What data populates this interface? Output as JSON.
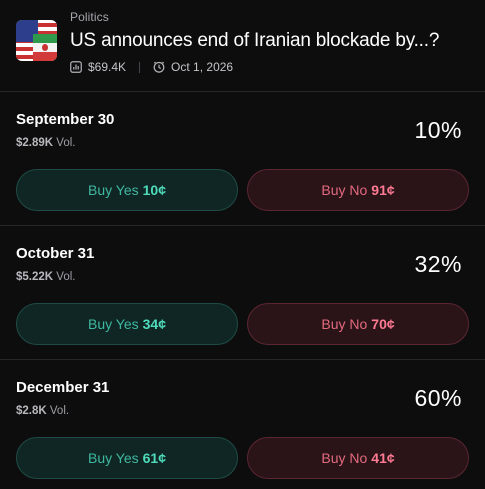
{
  "header": {
    "category": "Politics",
    "title": "US announces end of Iranian blockade by...?",
    "volume": "$69.4K",
    "end_date": "Oct 1, 2026"
  },
  "markets": [
    {
      "date": "September 30",
      "volume": "$2.89K",
      "vol_suffix": "Vol.",
      "probability": "10%",
      "yes_label": "Buy Yes",
      "yes_price": "10¢",
      "no_label": "Buy No",
      "no_price": "91¢"
    },
    {
      "date": "October 31",
      "volume": "$5.22K",
      "vol_suffix": "Vol.",
      "probability": "32%",
      "yes_label": "Buy Yes",
      "yes_price": "34¢",
      "no_label": "Buy No",
      "no_price": "70¢"
    },
    {
      "date": "December 31",
      "volume": "$2.8K",
      "vol_suffix": "Vol.",
      "probability": "60%",
      "yes_label": "Buy Yes",
      "yes_price": "61¢",
      "no_label": "Buy No",
      "no_price": "41¢"
    }
  ],
  "colors": {
    "background": "#0d0d0e",
    "yes_accent": "#3fb8a0",
    "no_accent": "#e4697f"
  },
  "icons": [
    "us-iran-flag-icon",
    "bar-chart-icon",
    "clock-icon"
  ]
}
